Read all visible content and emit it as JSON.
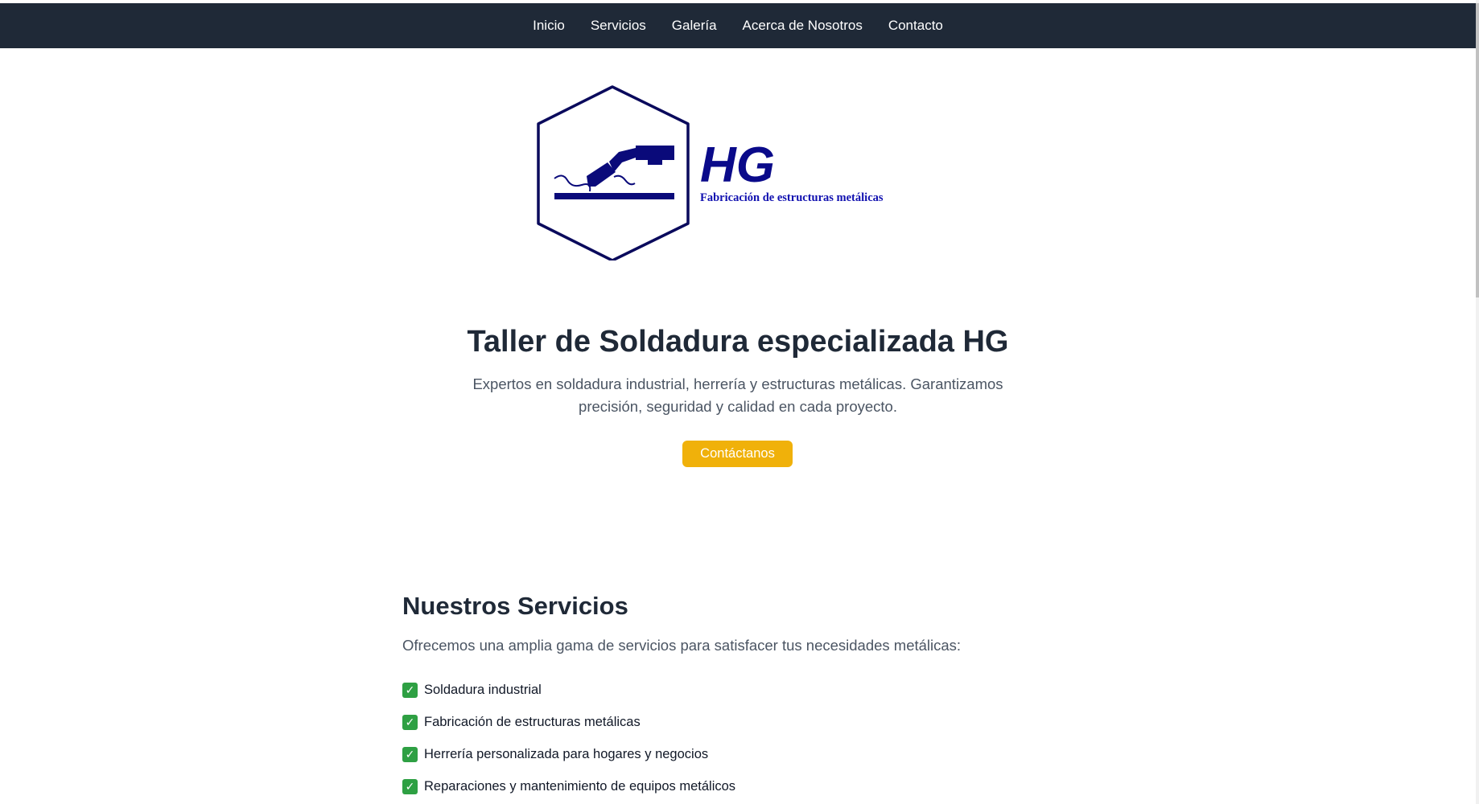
{
  "nav": {
    "items": [
      {
        "label": "Inicio"
      },
      {
        "label": "Servicios"
      },
      {
        "label": "Galería"
      },
      {
        "label": "Acerca de Nosotros"
      },
      {
        "label": "Contacto"
      }
    ]
  },
  "logo": {
    "brand": "HG",
    "tagline": "Fabricación de estructuras metálicas",
    "icon": "welding-torch-icon",
    "color": "#0a0a8a"
  },
  "hero": {
    "title": "Taller de Soldadura especializada HG",
    "description": "Expertos en soldadura industrial, herrería y estructuras metálicas. Garantizamos precisión, seguridad y calidad en cada proyecto.",
    "cta_label": "Contáctanos"
  },
  "services": {
    "title": "Nuestros Servicios",
    "intro": "Ofrecemos una amplia gama de servicios para satisfacer tus necesidades metálicas:",
    "items": [
      {
        "label": "Soldadura industrial"
      },
      {
        "label": "Fabricación de estructuras metálicas"
      },
      {
        "label": "Herrería personalizada para hogares y negocios"
      },
      {
        "label": "Reparaciones y mantenimiento de equipos metálicos"
      }
    ]
  },
  "colors": {
    "navbar": "#1f2937",
    "accent": "#f0b10a",
    "check": "#2ea043"
  }
}
